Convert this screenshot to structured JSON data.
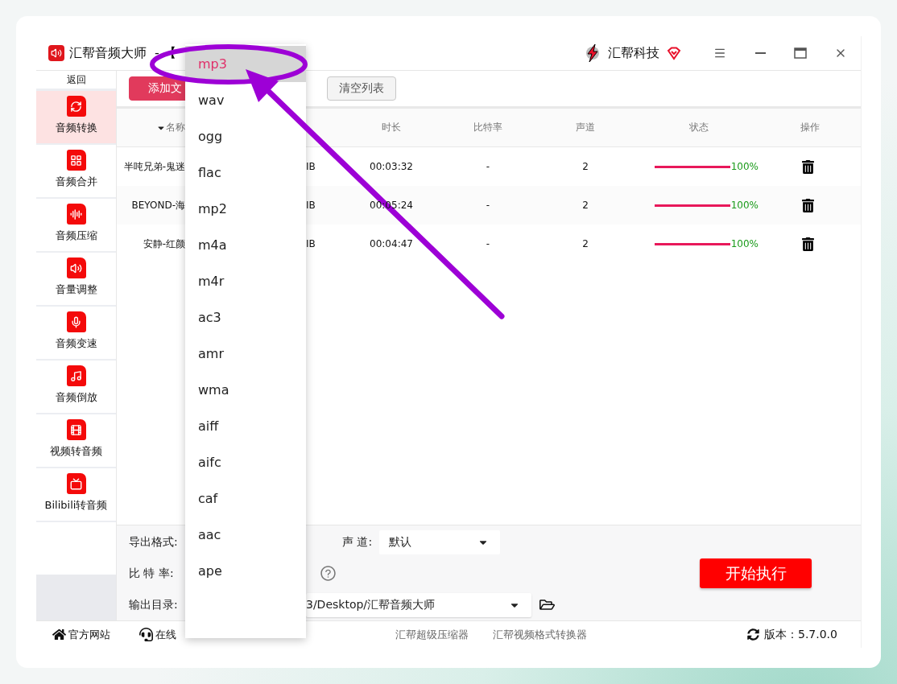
{
  "window": {
    "app_name": "汇帮音频大师",
    "title_suffix": "- 【",
    "brand": "汇帮科技"
  },
  "sidebar": {
    "back": "返回",
    "items": [
      {
        "label": "音频转换",
        "selected": true
      },
      {
        "label": "音频合并",
        "selected": false
      },
      {
        "label": "音频压缩",
        "selected": false
      },
      {
        "label": "音量调整",
        "selected": false
      },
      {
        "label": "音频变速",
        "selected": false
      },
      {
        "label": "音频倒放",
        "selected": false
      },
      {
        "label": "视频转音频",
        "selected": false
      },
      {
        "label": "Bilibili转音频",
        "selected": false
      }
    ]
  },
  "toolbar": {
    "buttons": [
      {
        "label": "添加文",
        "kind": "primary"
      },
      {
        "label": "清空列表",
        "kind": "secondary"
      }
    ]
  },
  "table": {
    "columns": [
      {
        "label": "名称",
        "sorted": true
      },
      {
        "label": "时长",
        "sorted": false
      },
      {
        "label": "比特率",
        "sorted": false
      },
      {
        "label": "声道",
        "sorted": false
      },
      {
        "label": "状态",
        "sorted": false
      },
      {
        "label": "操作",
        "sorted": false
      }
    ],
    "rows": [
      {
        "name": "半吨兄弟-鬼迷",
        "size": "IB",
        "duration": "00:03:32",
        "bitrate": "-",
        "channels": "2",
        "level": 1,
        "progress": "100%"
      },
      {
        "name": "BEYOND-海",
        "size": "IB",
        "duration": "00:05:24",
        "bitrate": "-",
        "channels": "2",
        "level": 1,
        "progress": "100%"
      },
      {
        "name": "安静-红颜",
        "size": "IB",
        "duration": "00:04:47",
        "bitrate": "-",
        "channels": "2",
        "level": 1,
        "progress": "100%"
      }
    ]
  },
  "settings": {
    "format_label": "导出格式:",
    "channel_label": "声 道:",
    "channel_value": "默认",
    "bitrate_label": "比 特 率:",
    "output_label": "输出目录:",
    "output_value": "3/Desktop/汇帮音频大师",
    "start_button": "开始执行"
  },
  "footer": {
    "links": [
      {
        "label": "官方网站",
        "kind": "home"
      },
      {
        "label": "在线",
        "kind": "support"
      }
    ],
    "products": [
      "汇帮超级压缩器",
      "汇帮视频格式转换器"
    ],
    "version": "版本：5.7.0.0"
  },
  "format_dropdown": {
    "options": [
      {
        "label": "mp3",
        "selected": true
      },
      {
        "label": "wav",
        "selected": false
      },
      {
        "label": "ogg",
        "selected": false
      },
      {
        "label": "flac",
        "selected": false
      },
      {
        "label": "mp2",
        "selected": false
      },
      {
        "label": "m4a",
        "selected": false
      },
      {
        "label": "m4r",
        "selected": false
      },
      {
        "label": "ac3",
        "selected": false
      },
      {
        "label": "amr",
        "selected": false
      },
      {
        "label": "wma",
        "selected": false
      },
      {
        "label": "aiff",
        "selected": false
      },
      {
        "label": "aifc",
        "selected": false
      },
      {
        "label": "caf",
        "selected": false
      },
      {
        "label": "aac",
        "selected": false
      },
      {
        "label": "ape",
        "selected": false
      }
    ]
  },
  "annotations": {
    "ellipse": {
      "color": "#9d00d6"
    },
    "arrow": {
      "color": "#9d00d6"
    }
  }
}
